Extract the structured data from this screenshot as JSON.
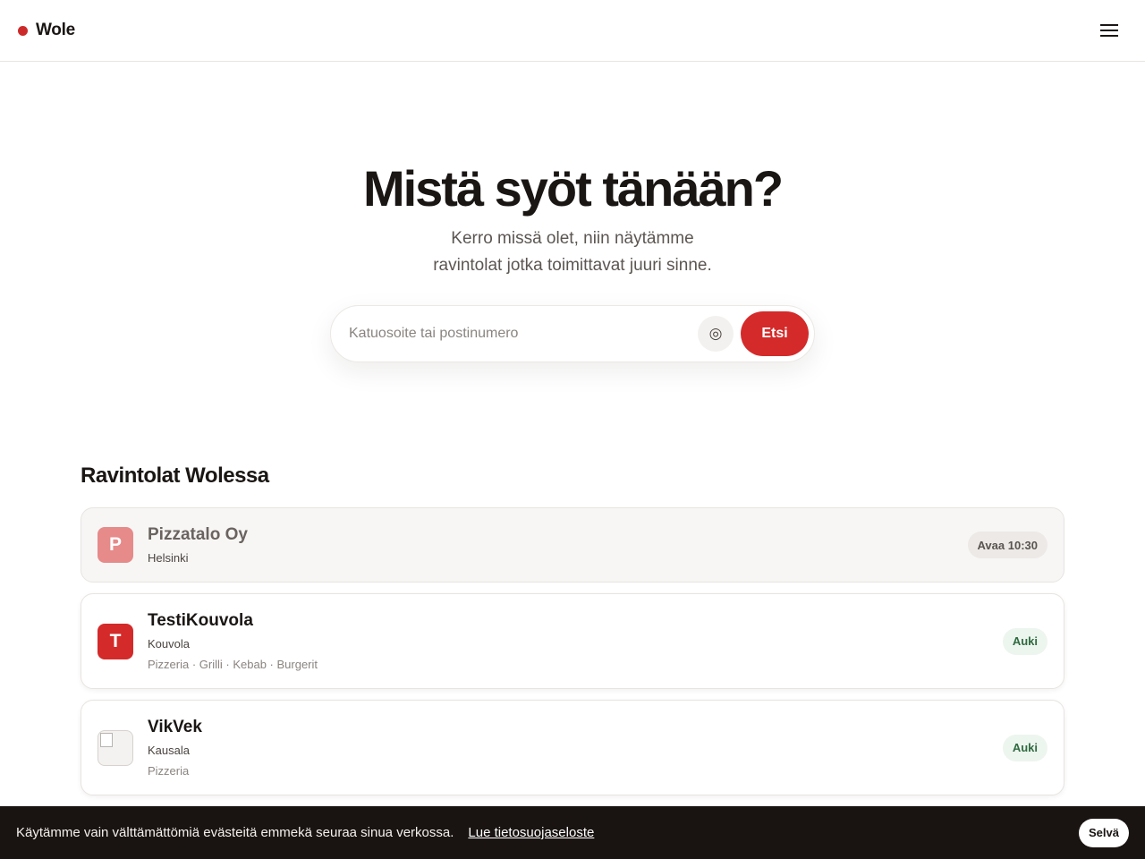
{
  "header": {
    "brand": "Wole",
    "brand_color": "#cc2a2a",
    "menu_icon": "hamburger-menu-icon"
  },
  "hero": {
    "title": "Mistä syöt tänään?",
    "subtitle_line1": "Kerro missä olet, niin näytämme",
    "subtitle_line2": "ravintolat jotka toimittavat juuri sinne."
  },
  "search": {
    "placeholder": "Katuosoite tai postinumero",
    "value": "",
    "locate_icon": "locate-target-icon",
    "button_label": "Etsi",
    "accent": "#d42a2a"
  },
  "restaurants": {
    "title": "Ravintolat Wolessa",
    "items": [
      {
        "initial": "P",
        "name": "Pizzatalo Oy",
        "city": "Helsinki",
        "tags": "",
        "status": "Avaa 10:30",
        "status_type": "closed"
      },
      {
        "initial": "T",
        "name": "TestiKouvola",
        "city": "Kouvola",
        "tags": "Pizzeria · Grilli · Kebab · Burgerit",
        "status": "Auki",
        "status_type": "open"
      },
      {
        "initial": "",
        "name": "VikVek",
        "city": "Kausala",
        "tags": "Pizzeria",
        "status": "Auki",
        "status_type": "open"
      }
    ]
  },
  "cookie_banner": {
    "text": "Käytämme vain välttämättömiä evästeitä emmekä seuraa sinua verkossa.",
    "link": "Lue tietosuojaseloste",
    "button": "Selvä"
  }
}
